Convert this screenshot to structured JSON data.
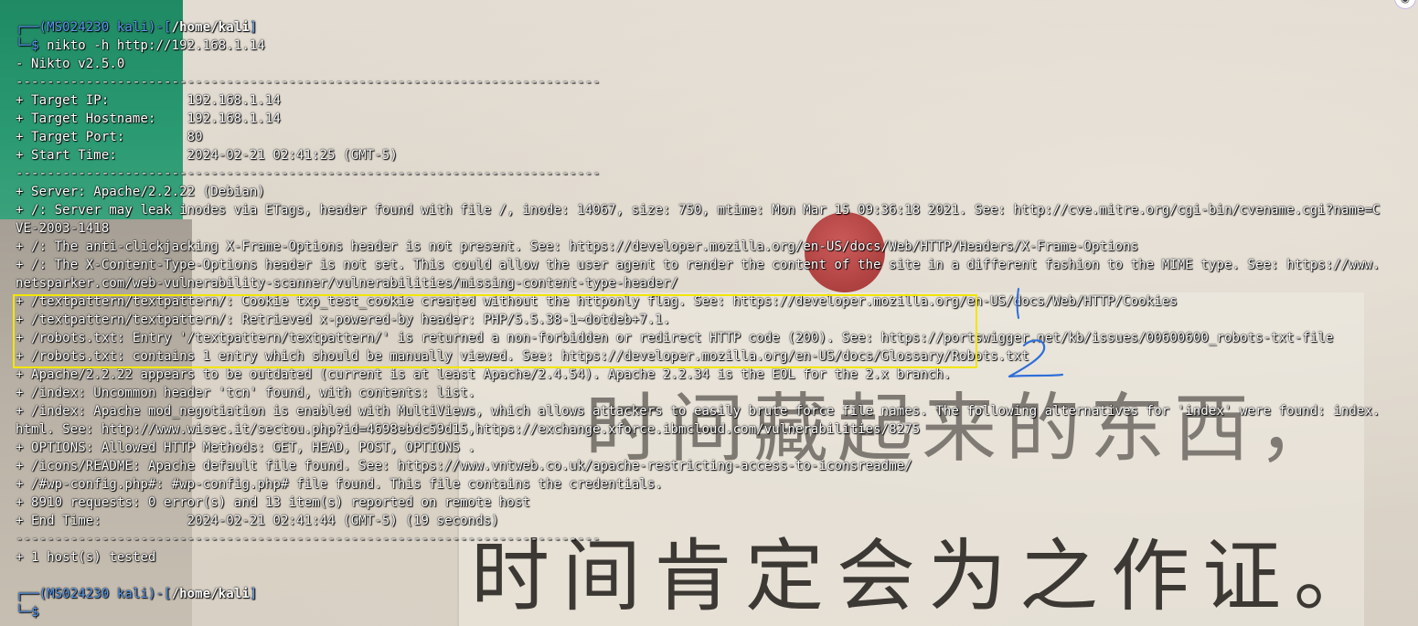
{
  "prompt": {
    "frame_top": "┌──(",
    "user_host": "MS024230 kali",
    "sep": ")-[",
    "path": "/home/kali",
    "close": "]",
    "frame_bottom": "└─",
    "symbol": "$"
  },
  "command": "nikto -h http://192.168.1.14",
  "lines": [
    "- Nikto v2.5.0",
    "---------------------------------------------------------------------------",
    "+ Target IP:          192.168.1.14",
    "+ Target Hostname:    192.168.1.14",
    "+ Target Port:        80",
    "+ Start Time:         2024-02-21 02:41:25 (GMT-5)",
    "---------------------------------------------------------------------------",
    "+ Server: Apache/2.2.22 (Debian)",
    "+ /: Server may leak inodes via ETags, header found with file /, inode: 14067, size: 750, mtime: Mon Mar 15 09:36:18 2021. See: http://cve.mitre.org/cgi-bin/cvename.cgi?name=C",
    "VE-2003-1418",
    "+ /: The anti-clickjacking X-Frame-Options header is not present. See: https://developer.mozilla.org/en-US/docs/Web/HTTP/Headers/X-Frame-Options",
    "+ /: The X-Content-Type-Options header is not set. This could allow the user agent to render the content of the site in a different fashion to the MIME type. See: https://www.",
    "netsparker.com/web-vulnerability-scanner/vulnerabilities/missing-content-type-header/",
    "+ /textpattern/textpattern/: Cookie txp_test_cookie created without the httponly flag. See: https://developer.mozilla.org/en-US/docs/Web/HTTP/Cookies",
    "+ /textpattern/textpattern/: Retrieved x-powered-by header: PHP/5.5.38-1~dotdeb+7.1.",
    "+ /robots.txt: Entry '/textpattern/textpattern/' is returned a non-forbidden or redirect HTTP code (200). See: https://portswigger.net/kb/issues/00600600_robots-txt-file",
    "+ /robots.txt: contains 1 entry which should be manually viewed. See: https://developer.mozilla.org/en-US/docs/Glossary/Robots.txt",
    "+ Apache/2.2.22 appears to be outdated (current is at least Apache/2.4.54). Apache 2.2.34 is the EOL for the 2.x branch.",
    "+ /index: Uncommon header 'tcn' found, with contents: list.",
    "+ /index: Apache mod_negotiation is enabled with MultiViews, which allows attackers to easily brute force file names. The following alternatives for 'index' were found: index.",
    "html. See: http://www.wisec.it/sectou.php?id=4698ebdc59d15,https://exchange.xforce.ibmcloud.com/vulnerabilities/8275",
    "+ OPTIONS: Allowed HTTP Methods: GET, HEAD, POST, OPTIONS .",
    "+ /icons/README: Apache default file found. See: https://www.vntweb.co.uk/apache-restricting-access-to-iconsreadme/",
    "+ /#wp-config.php#: #wp-config.php# file found. This file contains the credentials.",
    "+ 8910 requests: 0 error(s) and 13 item(s) reported on remote host",
    "+ End Time:           2024-02-21 02:41:44 (GMT-5) (19 seconds)",
    "---------------------------------------------------------------------------",
    "+ 1 host(s) tested"
  ],
  "annotation": {
    "number": "2",
    "color": "#2f6fd8"
  },
  "highlight_color": "#f2e500",
  "wallpaper": {
    "line1": "时间藏起来的东西，",
    "line2": "时间肯定会为之作证。"
  }
}
